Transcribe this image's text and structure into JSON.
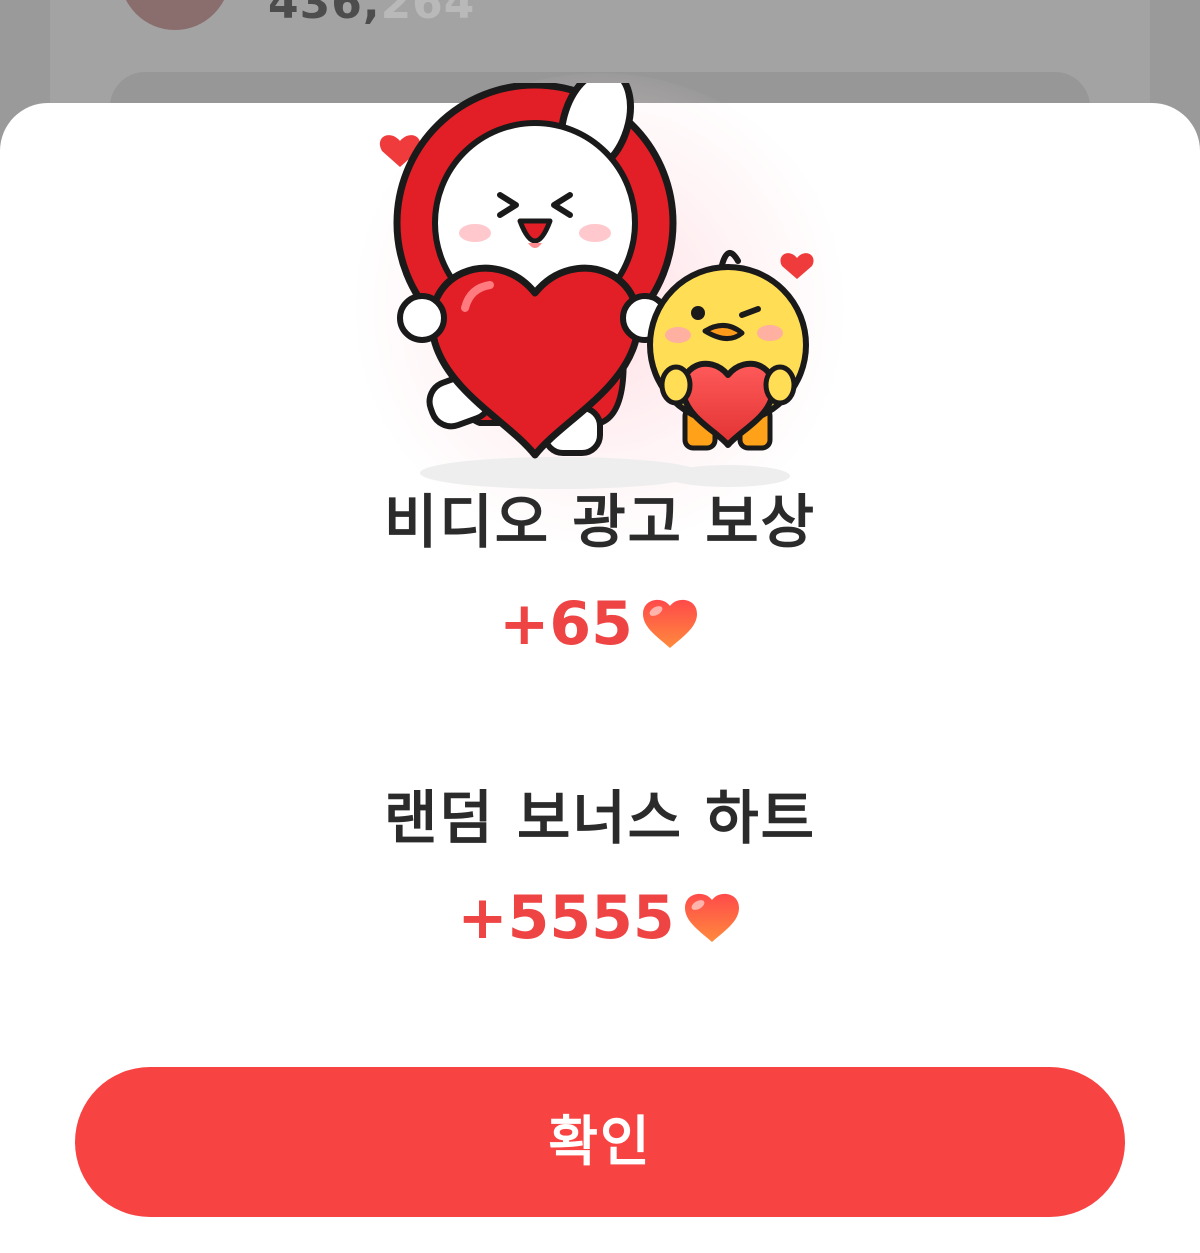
{
  "background": {
    "counter_visible": "436,",
    "counter_faded": "264"
  },
  "popup": {
    "reward1": {
      "title": "비디오 광고 보상",
      "amount": "+65"
    },
    "reward2": {
      "title": "랜덤 보너스 하트",
      "amount": "+5555"
    },
    "confirm_label": "확인"
  },
  "colors": {
    "accent": "#f84343",
    "reward_text": "#ef4444",
    "title_text": "#2b2b2b"
  },
  "icons": {
    "reward_heart": "heart-icon",
    "illustration": "rabbit-and-chick-holding-hearts"
  }
}
